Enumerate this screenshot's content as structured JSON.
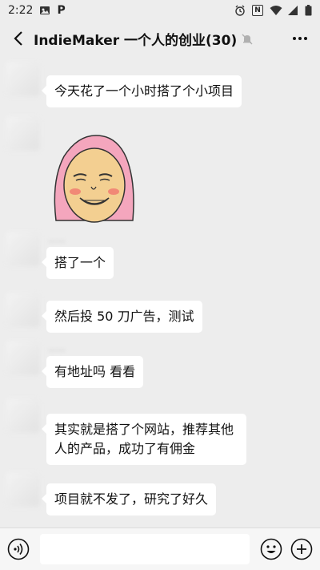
{
  "status_bar": {
    "time": "2:22",
    "notif_letter": "P",
    "nfc_letter": "N"
  },
  "header": {
    "title": "IndieMaker 一个人的创业(30)"
  },
  "messages": [
    {
      "type": "text",
      "text": "今天花了一个小时搭了个小项目"
    },
    {
      "type": "sticker",
      "icon": "pink-hood-face-sticker"
    },
    {
      "type": "text",
      "text": "搭了一个"
    },
    {
      "type": "text",
      "text": "然后投 50 刀广告，测试"
    },
    {
      "type": "text",
      "text": "有地址吗 看看"
    },
    {
      "type": "text",
      "text": "其实就是搭了个网站，推荐其他人的产品，成功了有佣金"
    },
    {
      "type": "text",
      "text": "项目就不发了，研究了好久"
    }
  ],
  "input_bar": {
    "placeholder": ""
  },
  "colors": {
    "background": "#ededed",
    "bubble": "#ffffff",
    "sticker_hood": "#f4a6bd",
    "sticker_face": "#f3cf91"
  }
}
